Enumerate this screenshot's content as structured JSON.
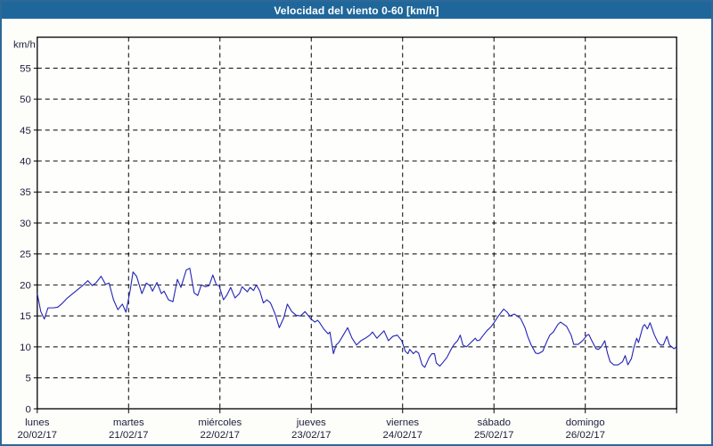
{
  "window": {
    "title": "Velocidad del viento 0-60 [km/h]"
  },
  "colors": {
    "titlebar_bg": "#1f679a",
    "titlebar_text": "#ffffff",
    "frame_border": "#2e6899",
    "background": "#fdfefa",
    "plot_background": "#fefefc",
    "grid": "#000000",
    "axis": "#000000",
    "tick_text": "#1d1d3a",
    "line": "#2222b8"
  },
  "chart_data": {
    "type": "line",
    "title": "Velocidad del viento 0-60 [km/h]",
    "unit_label": "km/h",
    "ylabel": "km/h",
    "xlabel": "",
    "ylim": [
      0,
      60
    ],
    "y_tick_step": 5,
    "y_ticks": [
      0,
      5,
      10,
      15,
      20,
      25,
      30,
      35,
      40,
      45,
      50,
      55
    ],
    "grid": "dashed",
    "legend": "none",
    "x_categories": [
      {
        "name": "lunes",
        "date": "20/02/17"
      },
      {
        "name": "martes",
        "date": "21/02/17"
      },
      {
        "name": "miércoles",
        "date": "22/02/17"
      },
      {
        "name": "jueves",
        "date": "23/02/17"
      },
      {
        "name": "viernes",
        "date": "24/02/17"
      },
      {
        "name": "sábado",
        "date": "25/02/17"
      },
      {
        "name": "domingo",
        "date": "26/02/17"
      }
    ],
    "x_unit": "days (0 = lunes 20/02/17 00:00)",
    "series": [
      {
        "name": "Velocidad del viento",
        "points": [
          [
            0.0,
            18.6
          ],
          [
            0.039,
            15.7
          ],
          [
            0.078,
            14.5
          ],
          [
            0.117,
            16.3
          ],
          [
            0.175,
            16.3
          ],
          [
            0.223,
            16.4
          ],
          [
            0.272,
            17.0
          ],
          [
            0.33,
            17.9
          ],
          [
            0.388,
            18.6
          ],
          [
            0.447,
            19.3
          ],
          [
            0.505,
            20.0
          ],
          [
            0.553,
            20.7
          ],
          [
            0.602,
            19.9
          ],
          [
            0.641,
            20.3
          ],
          [
            0.699,
            21.4
          ],
          [
            0.748,
            20.1
          ],
          [
            0.786,
            20.3
          ],
          [
            0.835,
            17.6
          ],
          [
            0.883,
            16.0
          ],
          [
            0.932,
            16.9
          ],
          [
            0.971,
            15.6
          ],
          [
            1.019,
            19.3
          ],
          [
            1.049,
            22.1
          ],
          [
            1.087,
            21.4
          ],
          [
            1.146,
            18.6
          ],
          [
            1.194,
            20.3
          ],
          [
            1.233,
            19.9
          ],
          [
            1.262,
            19.0
          ],
          [
            1.311,
            20.4
          ],
          [
            1.359,
            18.6
          ],
          [
            1.388,
            19.0
          ],
          [
            1.437,
            17.6
          ],
          [
            1.485,
            17.3
          ],
          [
            1.534,
            20.9
          ],
          [
            1.573,
            19.6
          ],
          [
            1.631,
            22.4
          ],
          [
            1.67,
            22.7
          ],
          [
            1.718,
            18.7
          ],
          [
            1.757,
            18.3
          ],
          [
            1.796,
            20.0
          ],
          [
            1.845,
            19.7
          ],
          [
            1.883,
            19.9
          ],
          [
            1.922,
            21.6
          ],
          [
            1.961,
            20.0
          ],
          [
            1.99,
            19.9
          ],
          [
            2.039,
            17.6
          ],
          [
            2.078,
            18.4
          ],
          [
            2.117,
            19.6
          ],
          [
            2.165,
            17.9
          ],
          [
            2.214,
            18.6
          ],
          [
            2.243,
            19.7
          ],
          [
            2.272,
            19.3
          ],
          [
            2.301,
            18.9
          ],
          [
            2.33,
            19.6
          ],
          [
            2.369,
            19.1
          ],
          [
            2.398,
            20.0
          ],
          [
            2.437,
            19.0
          ],
          [
            2.476,
            17.1
          ],
          [
            2.515,
            17.6
          ],
          [
            2.553,
            17.1
          ],
          [
            2.602,
            15.4
          ],
          [
            2.65,
            13.1
          ],
          [
            2.699,
            14.7
          ],
          [
            2.738,
            16.9
          ],
          [
            2.786,
            15.7
          ],
          [
            2.835,
            15.1
          ],
          [
            2.883,
            15.0
          ],
          [
            2.932,
            15.7
          ],
          [
            2.99,
            14.6
          ],
          [
            3.039,
            14.0
          ],
          [
            3.068,
            14.3
          ],
          [
            3.087,
            14.0
          ],
          [
            3.136,
            12.9
          ],
          [
            3.184,
            12.1
          ],
          [
            3.204,
            12.4
          ],
          [
            3.243,
            8.9
          ],
          [
            3.272,
            10.3
          ],
          [
            3.301,
            10.7
          ],
          [
            3.35,
            11.9
          ],
          [
            3.398,
            13.1
          ],
          [
            3.447,
            11.4
          ],
          [
            3.495,
            10.3
          ],
          [
            3.544,
            11.0
          ],
          [
            3.592,
            11.4
          ],
          [
            3.641,
            11.9
          ],
          [
            3.67,
            12.4
          ],
          [
            3.718,
            11.4
          ],
          [
            3.757,
            12.0
          ],
          [
            3.796,
            12.6
          ],
          [
            3.845,
            11.0
          ],
          [
            3.893,
            11.7
          ],
          [
            3.942,
            11.9
          ],
          [
            3.99,
            11.0
          ],
          [
            4.029,
            9.3
          ],
          [
            4.058,
            8.9
          ],
          [
            4.078,
            9.6
          ],
          [
            4.117,
            8.9
          ],
          [
            4.146,
            9.3
          ],
          [
            4.175,
            9.0
          ],
          [
            4.214,
            7.1
          ],
          [
            4.243,
            6.7
          ],
          [
            4.291,
            8.3
          ],
          [
            4.32,
            8.9
          ],
          [
            4.35,
            8.9
          ],
          [
            4.369,
            7.4
          ],
          [
            4.408,
            6.9
          ],
          [
            4.437,
            7.4
          ],
          [
            4.485,
            8.3
          ],
          [
            4.534,
            9.7
          ],
          [
            4.563,
            10.4
          ],
          [
            4.602,
            11.0
          ],
          [
            4.631,
            11.9
          ],
          [
            4.66,
            10.3
          ],
          [
            4.699,
            10.0
          ],
          [
            4.748,
            10.7
          ],
          [
            4.796,
            11.4
          ],
          [
            4.816,
            11.0
          ],
          [
            4.845,
            11.1
          ],
          [
            4.874,
            11.7
          ],
          [
            4.922,
            12.6
          ],
          [
            4.971,
            13.3
          ],
          [
            5.0,
            13.9
          ],
          [
            5.049,
            15.0
          ],
          [
            5.107,
            16.1
          ],
          [
            5.146,
            15.6
          ],
          [
            5.175,
            15.0
          ],
          [
            5.223,
            15.3
          ],
          [
            5.291,
            14.6
          ],
          [
            5.34,
            13.1
          ],
          [
            5.369,
            11.7
          ],
          [
            5.408,
            10.3
          ],
          [
            5.456,
            9.0
          ],
          [
            5.485,
            8.9
          ],
          [
            5.534,
            9.3
          ],
          [
            5.583,
            11.0
          ],
          [
            5.612,
            11.9
          ],
          [
            5.65,
            12.4
          ],
          [
            5.699,
            13.6
          ],
          [
            5.728,
            14.0
          ],
          [
            5.796,
            13.3
          ],
          [
            5.845,
            11.9
          ],
          [
            5.874,
            10.4
          ],
          [
            5.922,
            10.4
          ],
          [
            5.971,
            11.0
          ],
          [
            6.019,
            11.9
          ],
          [
            6.039,
            12.0
          ],
          [
            6.068,
            11.1
          ],
          [
            6.117,
            9.7
          ],
          [
            6.146,
            9.6
          ],
          [
            6.175,
            10.0
          ],
          [
            6.214,
            11.0
          ],
          [
            6.243,
            9.0
          ],
          [
            6.272,
            7.6
          ],
          [
            6.311,
            7.1
          ],
          [
            6.359,
            7.1
          ],
          [
            6.408,
            7.6
          ],
          [
            6.437,
            8.6
          ],
          [
            6.466,
            7.1
          ],
          [
            6.505,
            8.1
          ],
          [
            6.534,
            10.0
          ],
          [
            6.563,
            11.4
          ],
          [
            6.583,
            10.7
          ],
          [
            6.631,
            13.3
          ],
          [
            6.65,
            13.6
          ],
          [
            6.68,
            12.9
          ],
          [
            6.709,
            13.9
          ],
          [
            6.757,
            11.9
          ],
          [
            6.796,
            10.7
          ],
          [
            6.825,
            10.3
          ],
          [
            6.854,
            10.3
          ],
          [
            6.893,
            11.7
          ],
          [
            6.922,
            10.3
          ],
          [
            6.971,
            9.7
          ],
          [
            7.0,
            10.0
          ]
        ]
      }
    ]
  }
}
